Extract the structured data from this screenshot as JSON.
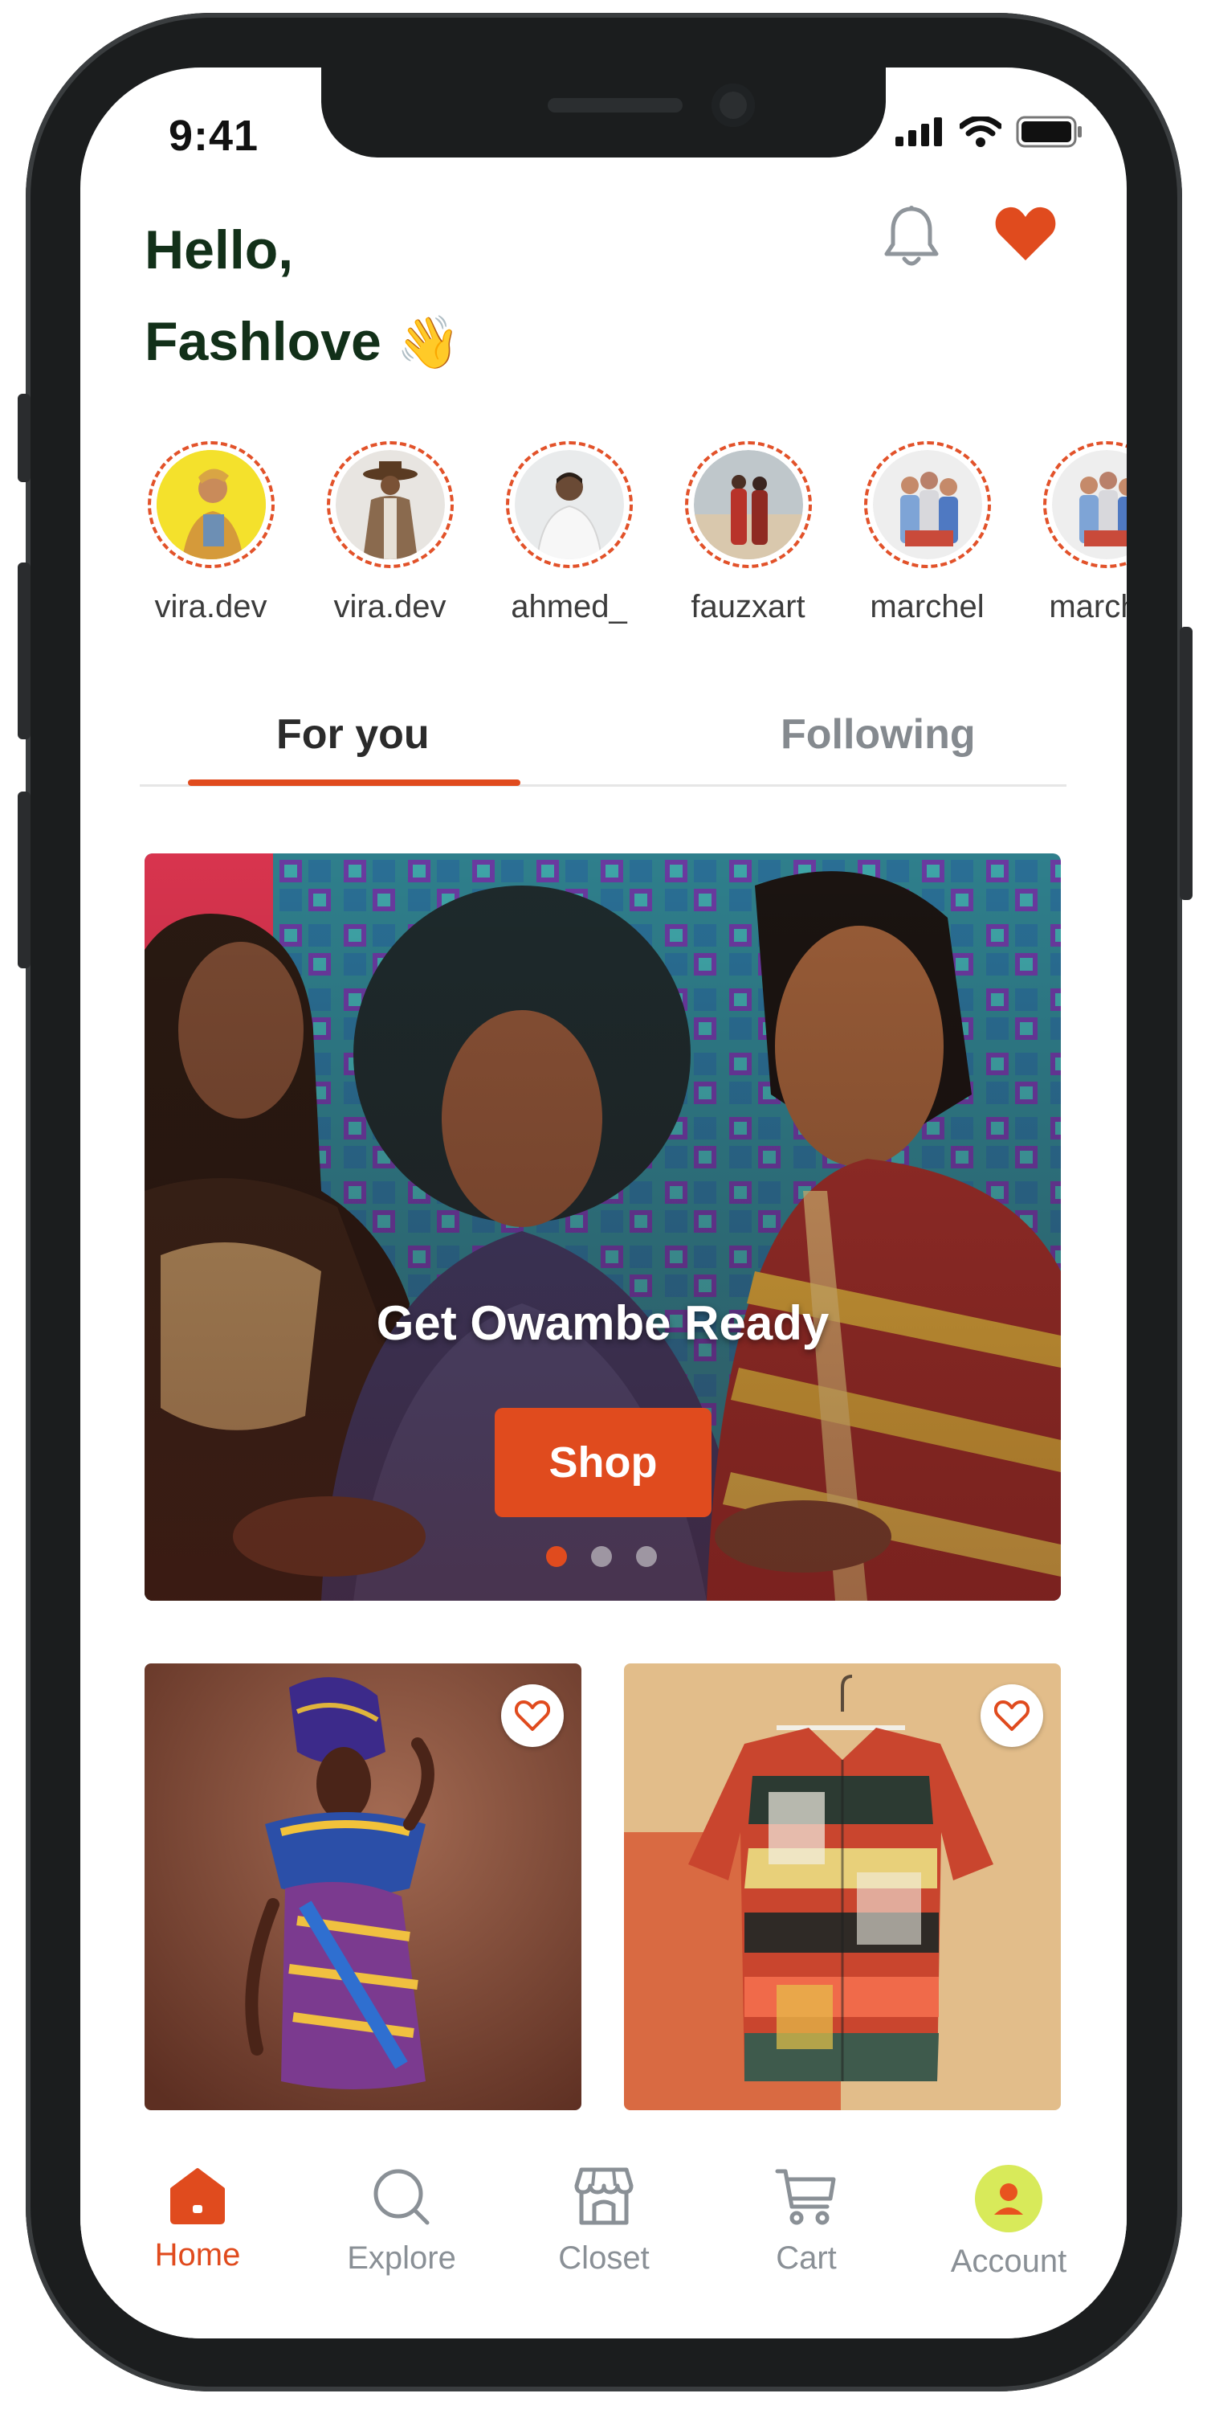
{
  "status_bar": {
    "time": "9:41"
  },
  "header": {
    "greeting_line1": "Hello,",
    "greeting_name": "Fashlove",
    "greeting_emoji": "👋"
  },
  "stories": [
    {
      "name": "vira.dev",
      "avatar": "yellow-portrait"
    },
    {
      "name": "vira.dev",
      "avatar": "hat-portrait"
    },
    {
      "name": "ahmed_",
      "avatar": "white-outfit-portrait"
    },
    {
      "name": "fauzxart",
      "avatar": "red-suit-portrait"
    },
    {
      "name": "marchel",
      "avatar": "group-portrait"
    },
    {
      "name": "marchel",
      "avatar": "group-portrait"
    }
  ],
  "tabs": [
    {
      "label": "For you",
      "active": true
    },
    {
      "label": "Following",
      "active": false
    }
  ],
  "banner": {
    "title": "Get Owambe Ready",
    "button_label": "Shop",
    "slide_count": 3,
    "active_slide": 1
  },
  "products": [
    {
      "image": "ankara-dress-model",
      "favorite_icon": "heart-outline-icon"
    },
    {
      "image": "printed-shirt-on-hanger",
      "favorite_icon": "heart-outline-icon"
    }
  ],
  "nav": [
    {
      "label": "Home",
      "icon": "home-icon",
      "active": true
    },
    {
      "label": "Explore",
      "icon": "search-icon",
      "active": false
    },
    {
      "label": "Closet",
      "icon": "closet-store-icon",
      "active": false
    },
    {
      "label": "Cart",
      "icon": "cart-icon",
      "active": false
    },
    {
      "label": "Account",
      "icon": "account-avatar-icon",
      "active": false
    }
  ],
  "colors": {
    "accent": "#e04b1e",
    "greeting": "#123019",
    "inactive": "#8a9096"
  }
}
